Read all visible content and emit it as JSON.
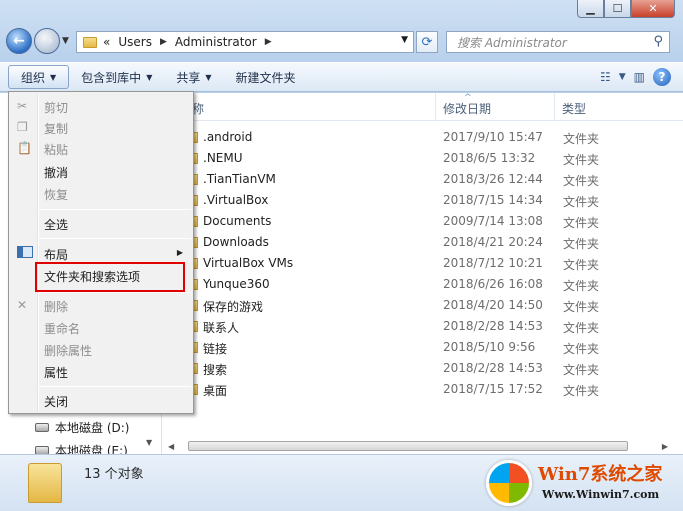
{
  "window": {
    "caption": {
      "minimize": "▁",
      "maximize": "☐",
      "close": "✕"
    }
  },
  "address": {
    "prefix": "«",
    "crumbs": [
      "Users",
      "Administrator"
    ]
  },
  "search": {
    "placeholder": "搜索 Administrator"
  },
  "toolbar": {
    "organize": "组织",
    "include_in_library": "包含到库中",
    "share": "共享",
    "new_folder": "新建文件夹"
  },
  "columns": {
    "name": "称",
    "date": "修改日期",
    "type": "类型"
  },
  "files": [
    {
      "name": ".android",
      "date": "2017/9/10 15:47",
      "type": "文件夹"
    },
    {
      "name": ".NEMU",
      "date": "2018/6/5 13:32",
      "type": "文件夹"
    },
    {
      "name": ".TianTianVM",
      "date": "2018/3/26 12:44",
      "type": "文件夹"
    },
    {
      "name": ".VirtualBox",
      "date": "2018/7/15 14:34",
      "type": "文件夹"
    },
    {
      "name": "Documents",
      "date": "2009/7/14 13:08",
      "type": "文件夹"
    },
    {
      "name": "Downloads",
      "date": "2018/4/21 20:24",
      "type": "文件夹"
    },
    {
      "name": "VirtualBox VMs",
      "date": "2018/7/12 10:21",
      "type": "文件夹"
    },
    {
      "name": "Yunque360",
      "date": "2018/6/26 16:08",
      "type": "文件夹"
    },
    {
      "name": "保存的游戏",
      "date": "2018/4/20 14:50",
      "type": "文件夹"
    },
    {
      "name": "联系人",
      "date": "2018/2/28 14:53",
      "type": "文件夹"
    },
    {
      "name": "链接",
      "date": "2018/5/10 9:56",
      "type": "文件夹"
    },
    {
      "name": "搜索",
      "date": "2018/2/28 14:53",
      "type": "文件夹"
    },
    {
      "name": "桌面",
      "date": "2018/7/15 17:52",
      "type": "文件夹"
    }
  ],
  "nav_pane": {
    "items": [
      "本地磁盘 (D:)",
      "本地磁盘 (E:)"
    ]
  },
  "menu": {
    "cut": "剪切",
    "copy": "复制",
    "paste": "粘贴",
    "undo": "撤消",
    "redo": "恢复",
    "select_all": "全选",
    "layout": "布局",
    "folder_options": "文件夹和搜索选项",
    "delete": "删除",
    "rename": "重命名",
    "remove_properties": "删除属性",
    "properties": "属性",
    "close": "关闭"
  },
  "details": {
    "count": "13 个对象"
  },
  "watermark": {
    "brand": "Win7系统之家",
    "url": "Www.Winwin7.com"
  },
  "colors": {
    "highlight_border": "#e00000",
    "disabled_text": "#8d8d8d"
  }
}
